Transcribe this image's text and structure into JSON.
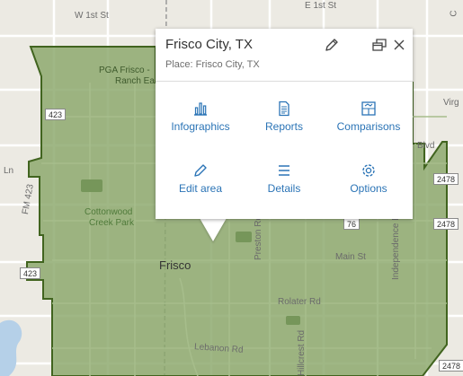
{
  "map": {
    "road_labels": [
      "W 1st St",
      "E 1st St",
      "Ln",
      "FM 423",
      "Preston Rd",
      "Main St",
      "Rolater Rd",
      "Lebanon Rd",
      "Hillcrest Rd",
      "Independence Pkwy",
      "Virg",
      "Blvd",
      "C"
    ],
    "shields": [
      "423",
      "423",
      "2478",
      "2478",
      "76",
      "2478"
    ],
    "places": {
      "pga": "PGA Frisco -",
      "pga_sub": "Ranch Ea",
      "cottonwood": "Cottonwood",
      "cottonwood_sub": "Creek Park",
      "city": "Frisco"
    },
    "colors": {
      "base": "#eceae3",
      "area_fill": "#8aa76a",
      "area_outline": "#41641f",
      "road": "#ffffff",
      "water": "#b5d0e8"
    }
  },
  "popup": {
    "title": "Frisco City, TX",
    "subtitle": "Place: Frisco City, TX",
    "actions": [
      "Infographics",
      "Reports",
      "Comparisons",
      "Edit area",
      "Details",
      "Options"
    ],
    "icons": {
      "edit": "pencil-icon",
      "dock": "dock-icon",
      "close": "close-icon"
    },
    "accent": "#2b74b6"
  }
}
